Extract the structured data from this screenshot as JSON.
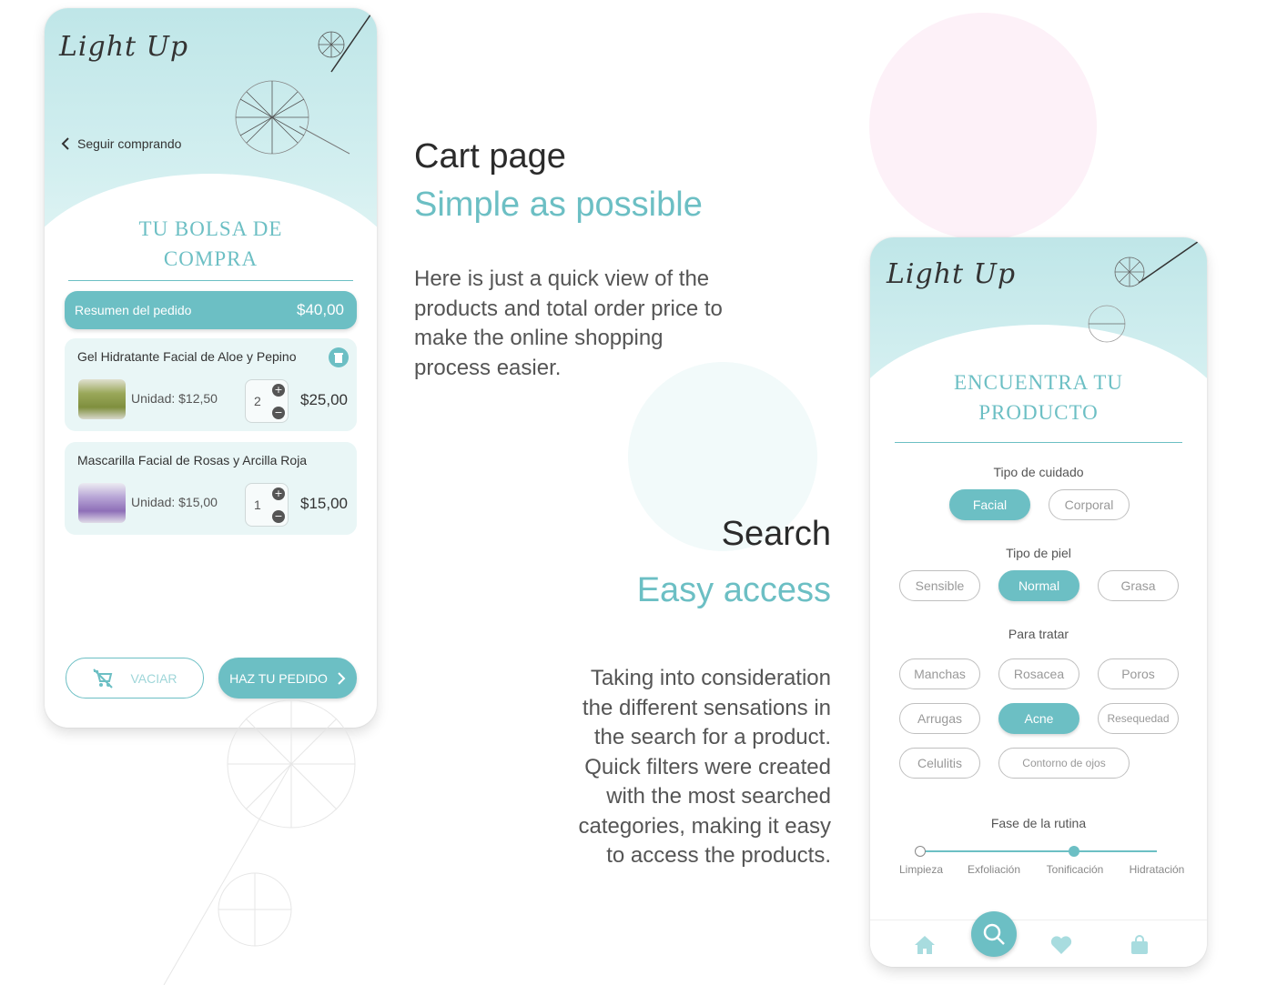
{
  "colors": {
    "accent": "#6cbfc4",
    "accent_light": "#e9f6f6",
    "text": "#333333"
  },
  "cart_phone": {
    "logo": "Light Up",
    "back_link": "Seguir comprando",
    "title_line1": "TU BOLSA DE",
    "title_line2": "COMPRA",
    "summary": {
      "label": "Resumen del pedido",
      "total": "$40,00"
    },
    "items": [
      {
        "name": "Gel Hidratante Facial de Aloe y Pepino",
        "unit": "Unidad: $12,50",
        "qty": "2",
        "total": "$25,00",
        "thumb_color": "#9aa85a"
      },
      {
        "name": "Mascarilla Facial de Rosas y Arcilla Roja",
        "unit": "Unidad: $15,00",
        "qty": "1",
        "total": "$15,00",
        "thumb_color": "#9a7fc0"
      }
    ],
    "empty_button": "VACIAR",
    "order_button": "HAZ TU PEDIDO"
  },
  "cart_section": {
    "heading": "Cart page",
    "subheading": "Simple as possible",
    "body": [
      "Here is just a quick view of the",
      "products and total order price to",
      "make the online shopping",
      "process easier."
    ]
  },
  "search_section": {
    "heading": "Search",
    "subheading": "Easy access",
    "body": [
      "Taking into consideration",
      "the different sensations in",
      "the search for a product.",
      "Quick filters were created",
      "with the most searched",
      "categories, making it easy",
      "to access the products."
    ]
  },
  "search_phone": {
    "logo": "Light Up",
    "title_line1": "ENCUENTRA TU",
    "title_line2": "PRODUCTO",
    "care_label": "Tipo de cuidado",
    "care_options": [
      "Facial",
      "Corporal"
    ],
    "care_selected": "Facial",
    "skin_label": "Tipo de piel",
    "skin_options": [
      "Sensible",
      "Normal",
      "Grasa"
    ],
    "skin_selected": "Normal",
    "treat_label": "Para tratar",
    "treat_options": [
      "Manchas",
      "Rosacea",
      "Poros",
      "Arrugas",
      "Acne",
      "Resequedad",
      "Celulitis",
      "Contorno de ojos"
    ],
    "treat_selected": "Acne",
    "routine_label": "Fase de la rutina",
    "routine_steps": [
      "Limpieza",
      "Exfoliación",
      "Tonificación",
      "Hidratación"
    ],
    "routine_selected": "Tonificación",
    "tabs": [
      "home-icon",
      "search-icon",
      "heart-icon",
      "bag-icon"
    ]
  }
}
